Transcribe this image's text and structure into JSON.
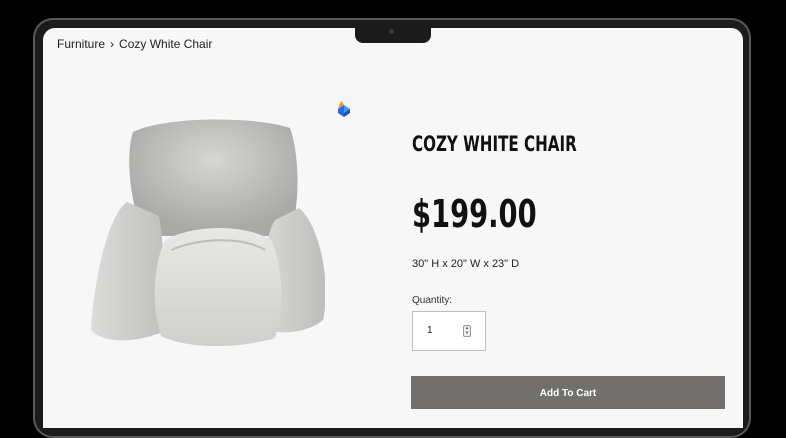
{
  "breadcrumb": {
    "parent": "Furniture",
    "separator": "›",
    "current": "Cozy White Chair"
  },
  "logo_icon": "brand-logo-icon",
  "product": {
    "title": "COZY WHITE CHAIR",
    "price": "$199.00",
    "dimensions": "30\" H x 20\" W x 23\" D",
    "image_icon": "chair-product-image"
  },
  "quantity": {
    "label": "Quantity:",
    "value": "1",
    "stepper_icon": "stepper-arrows-icon"
  },
  "cart": {
    "button_label": "Add To Cart"
  },
  "colors": {
    "button_bg": "#72706c",
    "screen_bg": "#f7f7f7",
    "bezel": "#1b1b1c"
  }
}
